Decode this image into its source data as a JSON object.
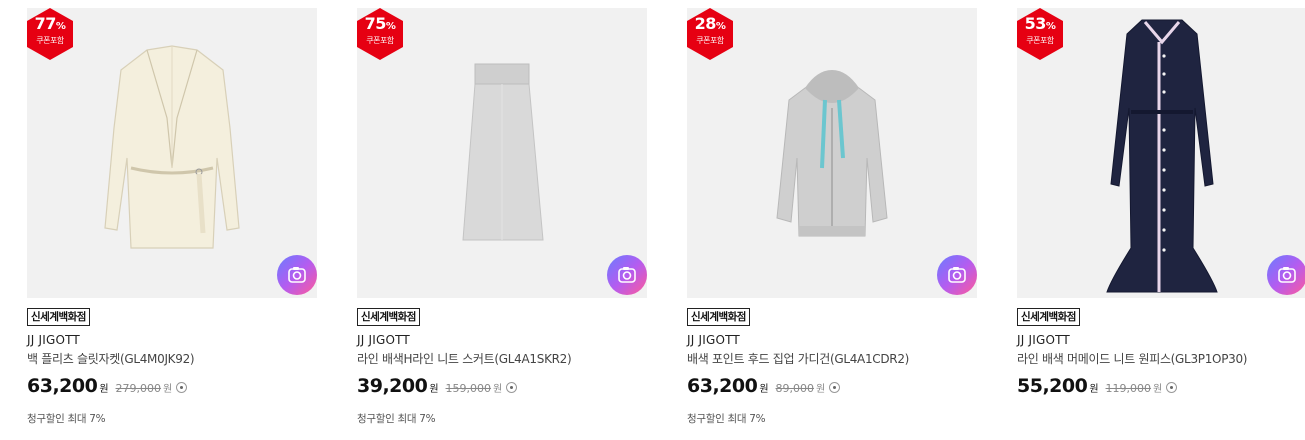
{
  "colors": {
    "badge_red": "#e60012",
    "thumb_bg": "#f1f1f1",
    "camera_gradient": [
      "#6a7cff",
      "#b45cf0",
      "#ff5a9a"
    ]
  },
  "products": [
    {
      "discount_pct": "77",
      "pct_sign": "%",
      "badge_sub": "쿠폰포함",
      "store": "신세계백화점",
      "brand": "JJ JIGOTT",
      "name": "백 플리츠 슬릿자켓(GL4M0JK92)",
      "price": "63,200",
      "currency": "원",
      "original_price": "279,000",
      "original_currency": "원",
      "benefit": "청구할인 최대 7%",
      "image": "ivory-jacket",
      "camera_icon": "camera-icon"
    },
    {
      "discount_pct": "75",
      "pct_sign": "%",
      "badge_sub": "쿠폰포함",
      "store": "신세계백화점",
      "brand": "JJ JIGOTT",
      "name": "라인 배색H라인 니트 스커트(GL4A1SKR2)",
      "price": "39,200",
      "currency": "원",
      "original_price": "159,000",
      "original_currency": "원",
      "benefit": "청구할인 최대 7%",
      "image": "grey-knit-skirt",
      "camera_icon": "camera-icon"
    },
    {
      "discount_pct": "28",
      "pct_sign": "%",
      "badge_sub": "쿠폰포함",
      "store": "신세계백화점",
      "brand": "JJ JIGOTT",
      "name": "배색 포인트 후드 집업 가디건(GL4A1CDR2)",
      "price": "63,200",
      "currency": "원",
      "original_price": "89,000",
      "original_currency": "원",
      "benefit": "청구할인 최대 7%",
      "image": "grey-hooded-cardigan",
      "camera_icon": "camera-icon"
    },
    {
      "discount_pct": "53",
      "pct_sign": "%",
      "badge_sub": "쿠폰포함",
      "store": "신세계백화점",
      "brand": "JJ JIGOTT",
      "name": "라인 배색 머메이드 니트 원피스(GL3P1OP30)",
      "price": "55,200",
      "currency": "원",
      "original_price": "119,000",
      "original_currency": "원",
      "benefit": "",
      "image": "navy-knit-dress",
      "camera_icon": "camera-icon"
    }
  ]
}
